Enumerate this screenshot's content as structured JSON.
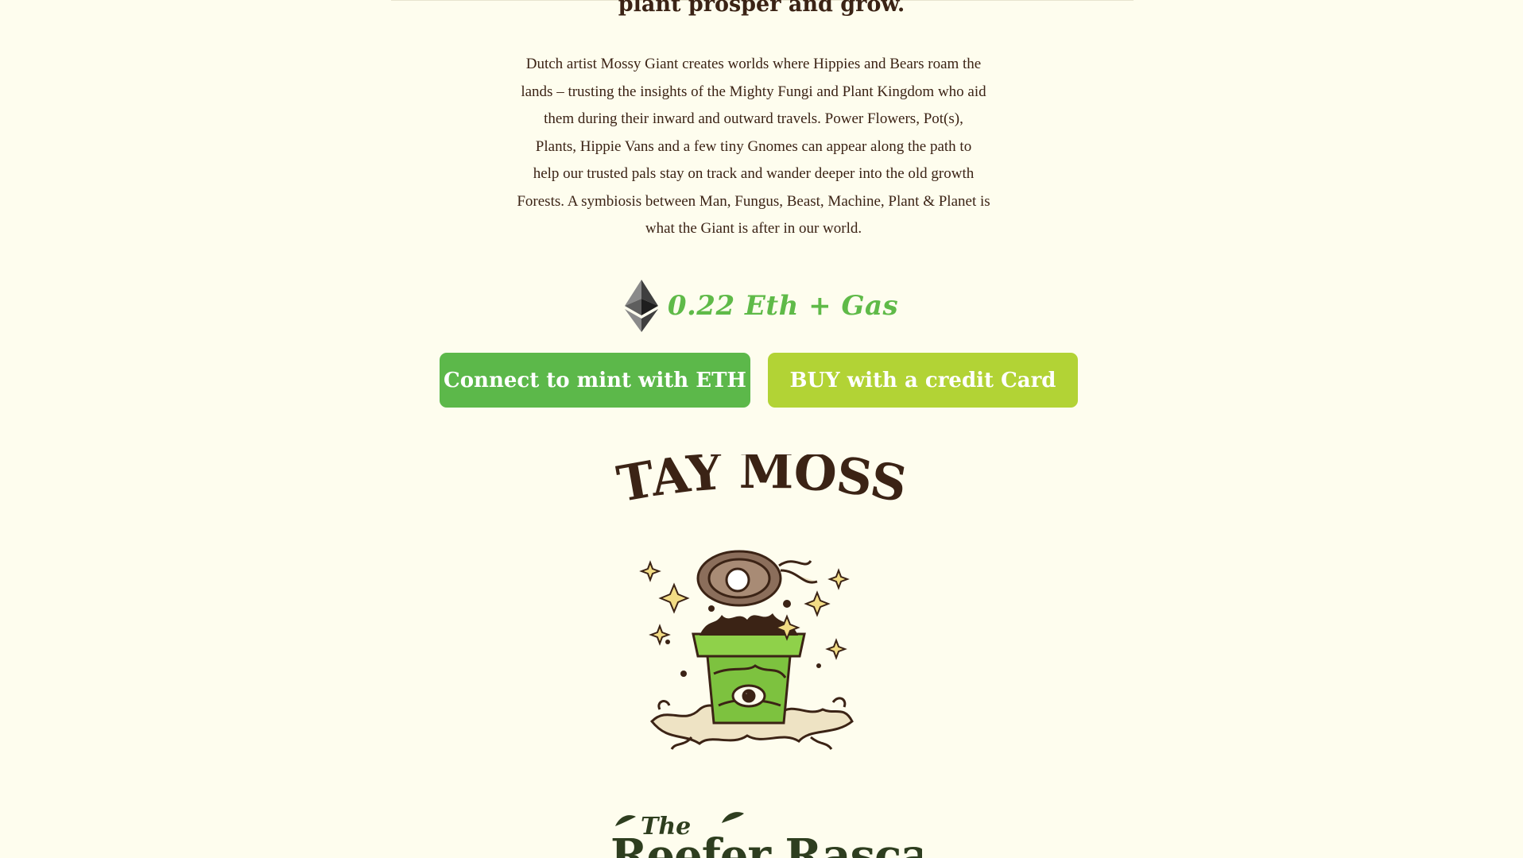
{
  "heading": "plant prosper and grow.",
  "description": "Dutch artist Mossy Giant creates worlds where Hippies and Bears roam the\nlands – trusting the insights of the Mighty Fungi and Plant Kingdom who aid\nthem during their inward and outward travels.  Power Flowers, Pot(s),\nPlants, Hippie Vans and a few tiny Gnomes can appear along the path to\nhelp our trusted pals stay on track and wander deeper into the old growth\nForests. A symbiosis between Man, Fungus, Beast, Machine, Plant & Planet is\nwhat the Giant is after in our world.",
  "price": {
    "icon": "ethereum-icon",
    "label": "0.22 Eth + Gas"
  },
  "buttons": {
    "connect_eth": "Connect to mint with ETH",
    "buy_card": "BUY with a credit Card"
  },
  "banner_text": "STAY MOSSY",
  "illustration": "exploding-flower-pot-illustration",
  "logo_text": {
    "small": "The",
    "large": "Reefer Rascals"
  },
  "colors": {
    "background": "#fefdee",
    "text": "#3b2315",
    "price_green": "#5fba48",
    "eth_button": "#5cb84a",
    "card_button": "#b2d335",
    "logo_green": "#2e3e1f"
  }
}
